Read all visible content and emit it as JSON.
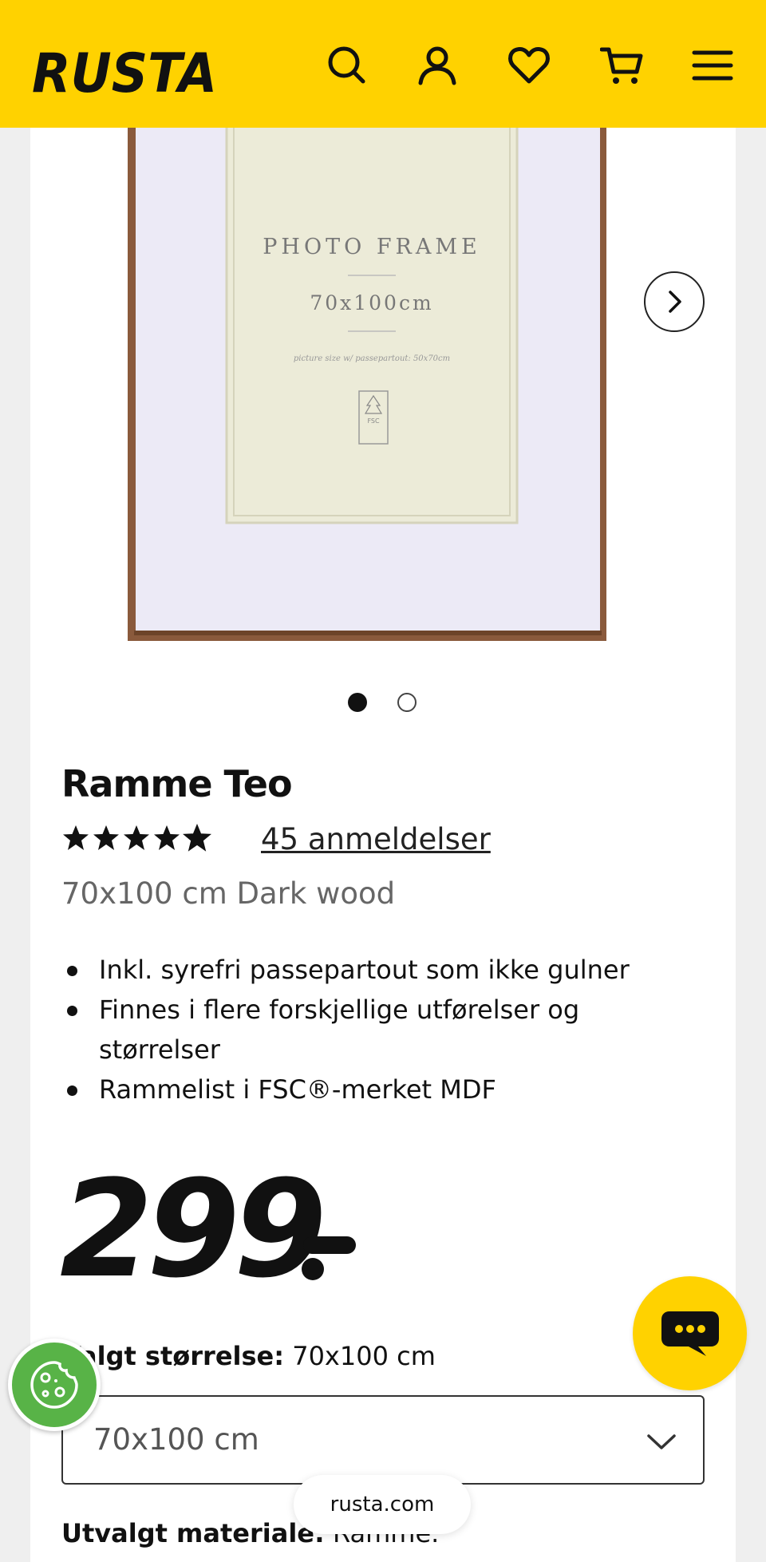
{
  "header": {
    "logo": "RUSTA",
    "icons": [
      "search-icon",
      "account-icon",
      "heart-icon",
      "cart-icon",
      "menu-icon"
    ],
    "background": "#ffd200"
  },
  "gallery": {
    "image": {
      "frame_title": "PHOTO FRAME",
      "frame_size": "70x100cm",
      "frame_note": "picture size w/ passepartout: 50x70cm",
      "fsc_label": "FSC"
    },
    "slide_index": 1,
    "slide_count": 2
  },
  "product": {
    "title": "Ramme Teo",
    "rating": 4.5,
    "reviews_label": "45 anmeldelser",
    "variant": "70x100 cm Dark wood",
    "features": [
      "Inkl. syrefri passepartout som ikke gulner",
      "Finnes i flere forskjellige utførelser og størrelser",
      "Rammelist i FSC®-merket MDF"
    ],
    "price": "299"
  },
  "options": {
    "size_label": "Valgt størrelse:",
    "size_value": "70x100 cm",
    "size_select_value": "70x100 cm",
    "material_label": "Utvalgt materiale:",
    "material_value": "Ramme."
  },
  "browser": {
    "url": "rusta.com"
  },
  "colors": {
    "brand_yellow": "#ffd200",
    "cookie_green": "#58b347",
    "frame_wood": "#8a5a3c"
  }
}
